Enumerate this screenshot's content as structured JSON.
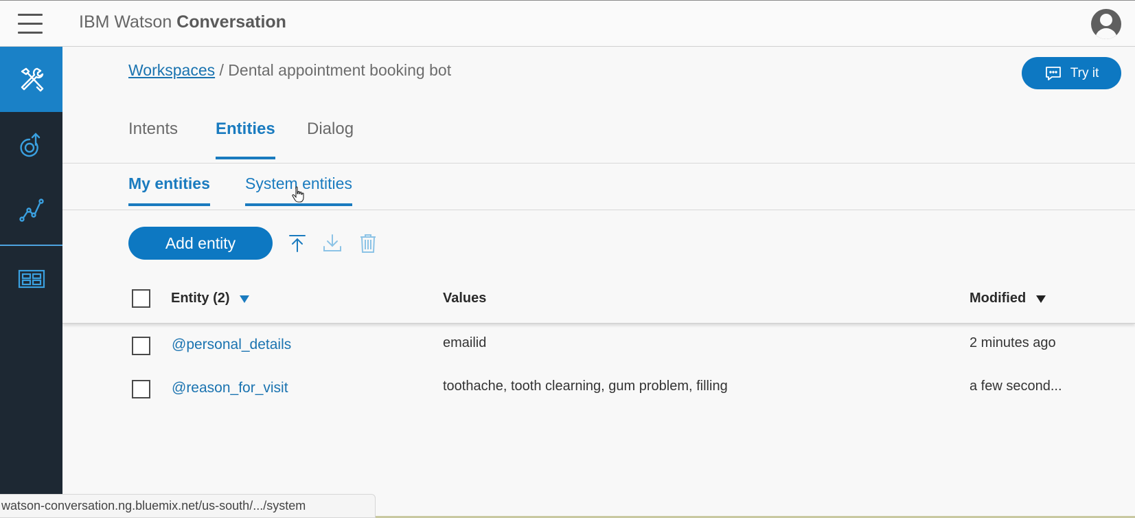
{
  "header": {
    "app_title_prefix": "IBM Watson ",
    "app_title_bold": "Conversation"
  },
  "sidebar": {
    "items": [
      {
        "icon": "tools-icon",
        "active": true
      },
      {
        "icon": "deploy-icon",
        "active": false
      },
      {
        "icon": "analytics-icon",
        "active": false
      },
      {
        "icon": "workspaces-icon",
        "active": false
      }
    ]
  },
  "breadcrumb": {
    "link": "Workspaces",
    "separator": " / ",
    "current": "Dental appointment booking bot"
  },
  "try_button": {
    "label": "Try it"
  },
  "tabs": [
    {
      "label": "Intents",
      "active": false
    },
    {
      "label": "Entities",
      "active": true
    },
    {
      "label": "Dialog",
      "active": false
    }
  ],
  "subtabs": [
    {
      "label": "My entities",
      "active": true
    },
    {
      "label": "System entities",
      "active": false
    }
  ],
  "toolbar": {
    "add_label": "Add entity",
    "icons": [
      "upload-icon",
      "download-icon",
      "trash-icon"
    ]
  },
  "table": {
    "headers": {
      "entity": "Entity (2)",
      "values": "Values",
      "modified": "Modified"
    },
    "rows": [
      {
        "name": "@personal_details",
        "values": "emailid",
        "modified": "2 minutes ago"
      },
      {
        "name": "@reason_for_visit",
        "values": "toothache, tooth clearning, gum problem, filling",
        "modified": "a few second..."
      }
    ]
  },
  "status_bar": {
    "url": "watson-conversation.ng.bluemix.net/us-south/.../system"
  },
  "colors": {
    "accent": "#0d78c2",
    "sidebar": "#1d2833",
    "link": "#1a73b0"
  }
}
